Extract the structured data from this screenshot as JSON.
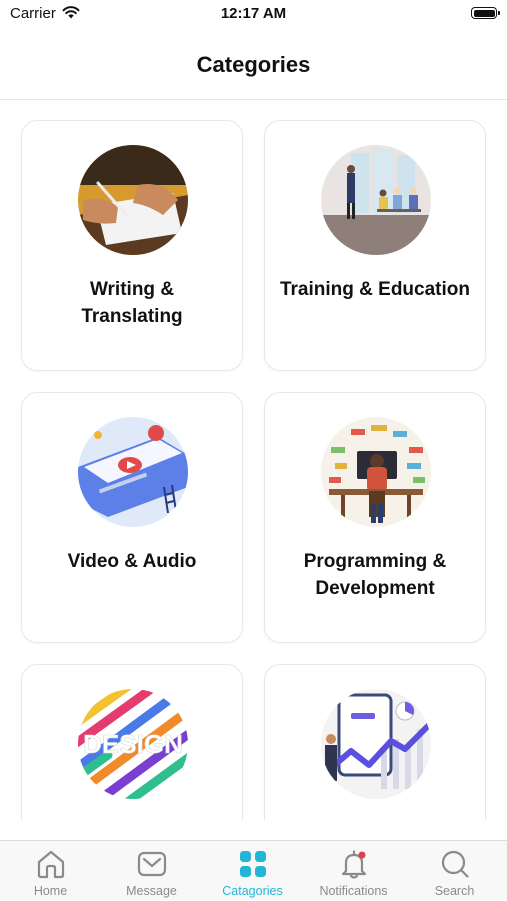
{
  "status_bar": {
    "carrier": "Carrier",
    "time": "12:17 AM"
  },
  "header": {
    "title": "Categories"
  },
  "categories": [
    {
      "label": "Writing &\nTranslating",
      "image": "writing-photo"
    },
    {
      "label": "Training & Education",
      "image": "training-illustration"
    },
    {
      "label": "Video & Audio",
      "image": "video-illustration"
    },
    {
      "label": "Programming &\nDevelopment",
      "image": "programming-illustration"
    },
    {
      "label": "",
      "image": "design-illustration"
    },
    {
      "label": "",
      "image": "marketing-illustration"
    }
  ],
  "tabs": [
    {
      "label": "Home",
      "icon": "home-icon",
      "active": false
    },
    {
      "label": "Message",
      "icon": "message-icon",
      "active": false
    },
    {
      "label": "Catagories",
      "icon": "categories-icon",
      "active": true
    },
    {
      "label": "Notifications",
      "icon": "bell-icon",
      "active": false
    },
    {
      "label": "Search",
      "icon": "search-icon",
      "active": false
    }
  ],
  "colors": {
    "accent": "#22b5d6",
    "inactive": "#8a8a8a",
    "notification_dot": "#e53950"
  }
}
